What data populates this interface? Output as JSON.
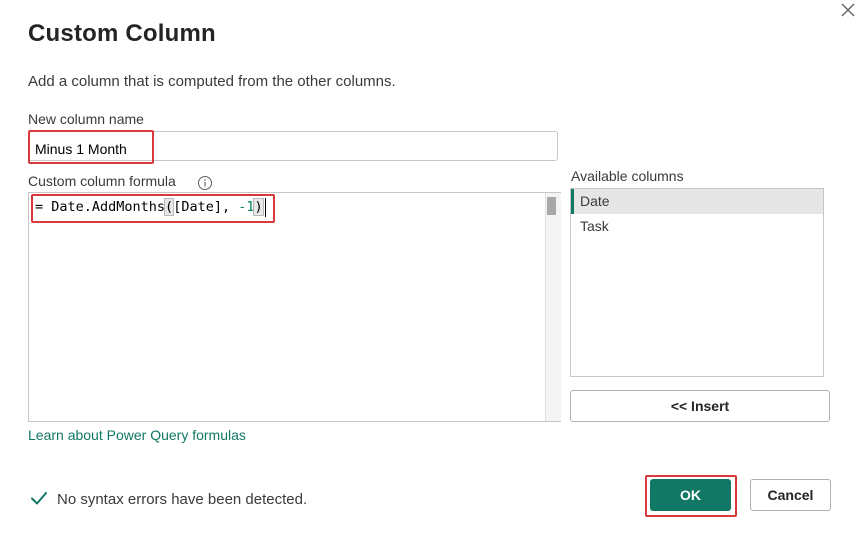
{
  "dialog": {
    "title": "Custom Column",
    "description": "Add a column that is computed from the other columns."
  },
  "column_name": {
    "label": "New column name",
    "value": "Minus 1 Month"
  },
  "formula": {
    "label": "Custom column formula",
    "prefix": "= Date.AddMonths",
    "open_paren": "(",
    "middle": "[Date], ",
    "number": "-1",
    "close_paren": ")"
  },
  "available_columns": {
    "label": "Available columns",
    "items": [
      {
        "label": "Date",
        "selected": true
      },
      {
        "label": "Task",
        "selected": false
      }
    ]
  },
  "buttons": {
    "insert": "<< Insert",
    "ok": "OK",
    "cancel": "Cancel"
  },
  "links": {
    "learn": "Learn about Power Query formulas"
  },
  "status": {
    "text": "No syntax errors have been detected."
  },
  "colors": {
    "accent": "#117865",
    "highlight": "#d9393c"
  },
  "icons": [
    "close-icon",
    "info-icon",
    "check-icon"
  ]
}
